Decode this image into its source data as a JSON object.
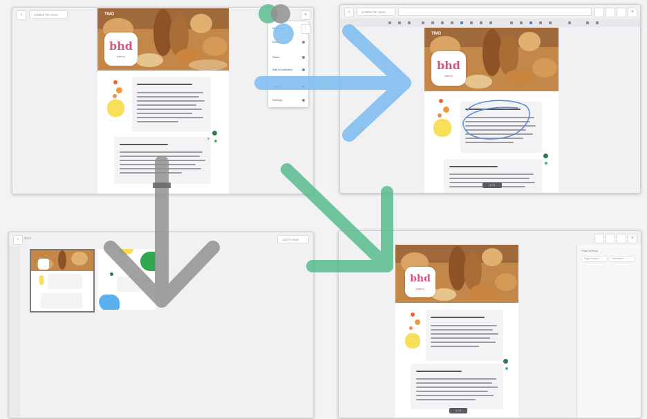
{
  "window_tl": {
    "back_glyph": "‹",
    "doc_tab": "Untitled file name",
    "close_glyph": "×",
    "menu_items": [
      "Annotate",
      "Draw",
      "Share",
      "Add to collection",
      "Highlight",
      "Settings"
    ]
  },
  "window_tr": {
    "back_glyph": "‹",
    "doc_tab": "Untitled file name",
    "page_counter": "1 / 2"
  },
  "window_bl": {
    "back_glyph": "‹",
    "tab_label": "Back",
    "action_label": "Add to page"
  },
  "window_br": {
    "page_counter": "1 / 2",
    "side_title": "Page settings",
    "side_fields": [
      "Page number",
      "Orientation"
    ]
  },
  "brand": {
    "banner_tag": "TWO",
    "logo_text": "bhd",
    "logo_sub": "bakery"
  },
  "colors": {
    "arrow_blue": "#7bbcf0",
    "arrow_green": "#4fb888",
    "arrow_gray": "#8e8e8e",
    "circle_blue": "#5a8fd6",
    "logo_pink": "#d5567a"
  },
  "icons": {
    "back": "chevron-left-icon",
    "close": "close-icon",
    "more": "more-icon"
  }
}
